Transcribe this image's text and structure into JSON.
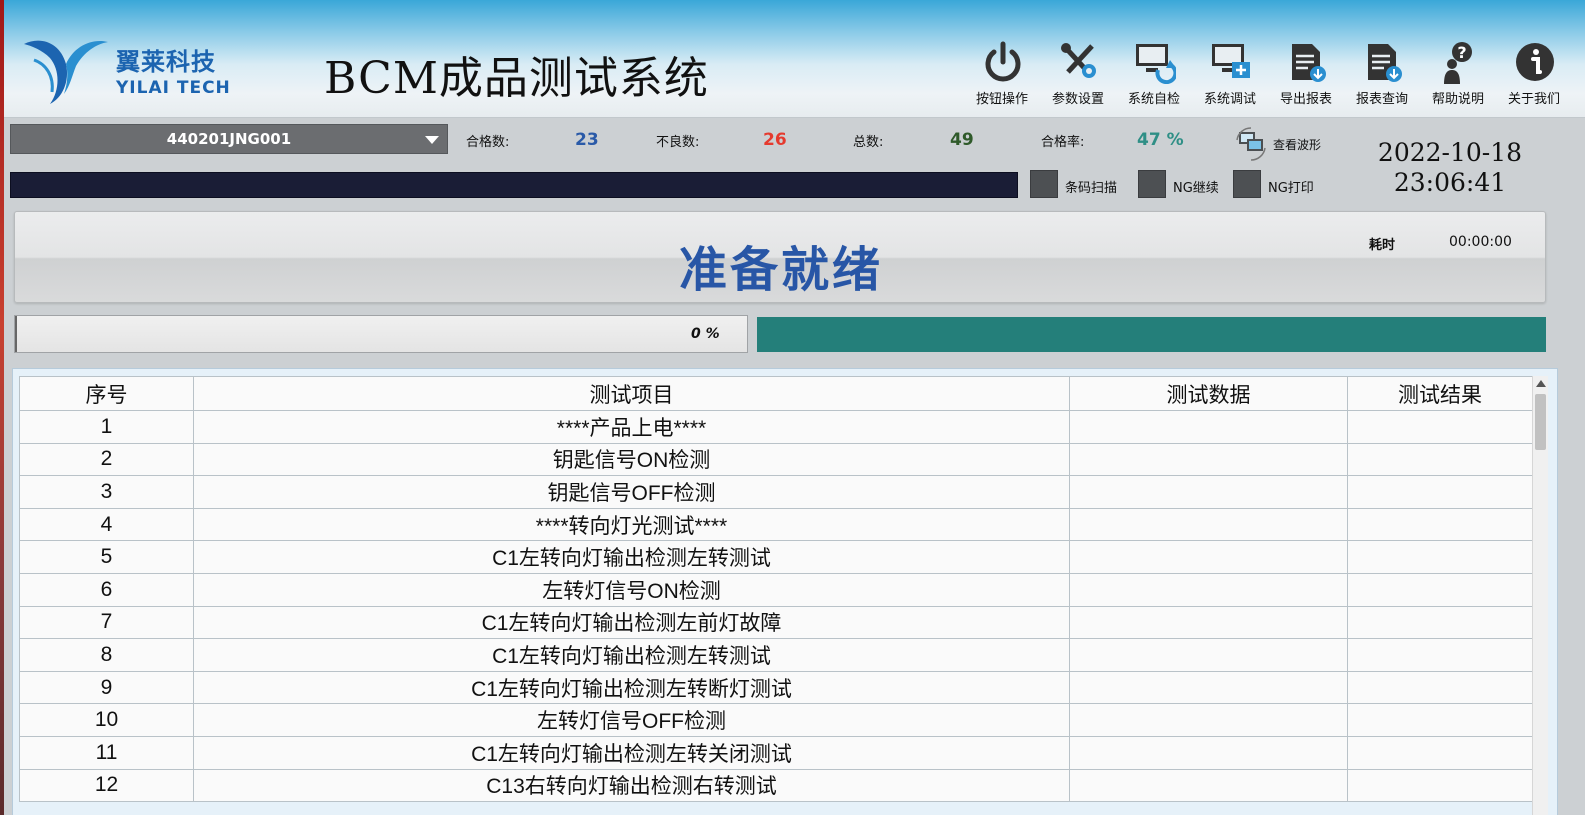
{
  "header": {
    "logo_cn": "翼莱科技",
    "logo_en": "YILAI TECH",
    "title": "BCM成品测试系统",
    "toolbar": [
      {
        "label": "按钮操作",
        "icon": "power-icon"
      },
      {
        "label": "参数设置",
        "icon": "tools-icon"
      },
      {
        "label": "系统自检",
        "icon": "monitor-refresh-icon"
      },
      {
        "label": "系统调试",
        "icon": "monitor-add-icon"
      },
      {
        "label": "导出报表",
        "icon": "document-export-icon"
      },
      {
        "label": "报表查询",
        "icon": "document-query-icon"
      },
      {
        "label": "帮助说明",
        "icon": "help-icon"
      },
      {
        "label": "关于我们",
        "icon": "info-icon"
      }
    ]
  },
  "product": {
    "selected": "440201JNG001"
  },
  "stats": {
    "pass_label": "合格数:",
    "pass_value": "23",
    "fail_label": "不良数:",
    "fail_value": "26",
    "total_label": "总数:",
    "total_value": "49",
    "rate_label": "合格率:",
    "rate_value": "47 %",
    "colors": {
      "pass": "#2a5aa8",
      "fail": "#e53a2e",
      "total": "#2f5a2a",
      "rate": "#2f8f86"
    }
  },
  "waveform": {
    "label": "查看波形",
    "icon": "waveform-monitor-icon"
  },
  "datetime": {
    "date": "2022-10-18",
    "time": "23:06:41"
  },
  "options": {
    "barcode_scan": "条码扫描",
    "ng_continue": "NG继续",
    "ng_print": "NG打印"
  },
  "status": {
    "text": "准备就绪",
    "elapsed_label": "耗时",
    "elapsed_value": "00:00:00"
  },
  "progress": {
    "percent_text": "0 %",
    "fraction": 0
  },
  "table": {
    "headers": [
      "序号",
      "测试项目",
      "测试数据",
      "测试结果"
    ],
    "rows": [
      {
        "no": "1",
        "item": "****产品上电****",
        "data": "",
        "result": ""
      },
      {
        "no": "2",
        "item": "钥匙信号ON检测",
        "data": "",
        "result": ""
      },
      {
        "no": "3",
        "item": "钥匙信号OFF检测",
        "data": "",
        "result": ""
      },
      {
        "no": "4",
        "item": "****转向灯光测试****",
        "data": "",
        "result": ""
      },
      {
        "no": "5",
        "item": "C1左转向灯输出检测左转测试",
        "data": "",
        "result": ""
      },
      {
        "no": "6",
        "item": "左转灯信号ON检测",
        "data": "",
        "result": ""
      },
      {
        "no": "7",
        "item": "C1左转向灯输出检测左前灯故障",
        "data": "",
        "result": ""
      },
      {
        "no": "8",
        "item": "C1左转向灯输出检测左转测试",
        "data": "",
        "result": ""
      },
      {
        "no": "9",
        "item": "C1左转向灯输出检测左转断灯测试",
        "data": "",
        "result": ""
      },
      {
        "no": "10",
        "item": "左转灯信号OFF检测",
        "data": "",
        "result": ""
      },
      {
        "no": "11",
        "item": "C1左转向灯输出检测左转关闭测试",
        "data": "",
        "result": ""
      },
      {
        "no": "12",
        "item": "C13右转向灯输出检测右转测试",
        "data": "",
        "result": ""
      }
    ]
  }
}
